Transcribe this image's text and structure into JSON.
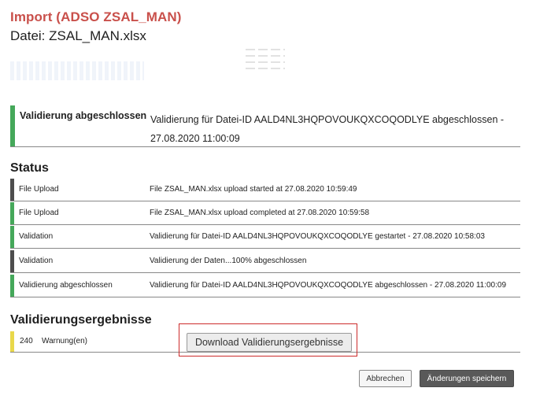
{
  "header": {
    "title": "Import  (ADSO ZSAL_MAN)",
    "subtitle": "Datei: ZSAL_MAN.xlsx"
  },
  "validation_banner": {
    "label": "Validierung abgeschlossen",
    "message_line1": "Validierung für Datei-ID AALD4NL3HQPOVOUKQXCOQODLYE abgeschlossen -",
    "message_line2": "27.08.2020 11:00:09",
    "color": "#45a85a"
  },
  "status": {
    "heading": "Status",
    "rows": [
      {
        "step": "File Upload",
        "message": "File ZSAL_MAN.xlsx upload started at 27.08.2020 10:59:49",
        "color": "#4d4d4d"
      },
      {
        "step": "File Upload",
        "message": "File ZSAL_MAN.xlsx upload completed at 27.08.2020 10:59:58",
        "color": "#45a85a"
      },
      {
        "step": "Validation",
        "message": "Validierung für Datei-ID AALD4NL3HQPOVOUKQXCOQODLYE gestartet - 27.08.2020 10:58:03",
        "color": "#45a85a"
      },
      {
        "step": "Validation",
        "message": "Validierung der Daten...100% abgeschlossen",
        "color": "#4d4d4d"
      },
      {
        "step": "Validierung abgeschlossen",
        "message": "Validierung für Datei-ID AALD4NL3HQPOVOUKQXCOQODLYE abgeschlossen - 27.08.2020 11:00:09",
        "color": "#45a85a"
      }
    ]
  },
  "results": {
    "heading": "Validierungsergebnisse",
    "count": "240",
    "unit": "Warnung(en)",
    "color": "#e9d84a",
    "download_label": "Download Validierungsergebnisse"
  },
  "footer": {
    "cancel_label": "Abbrechen",
    "save_label": "Änderungen speichern"
  }
}
